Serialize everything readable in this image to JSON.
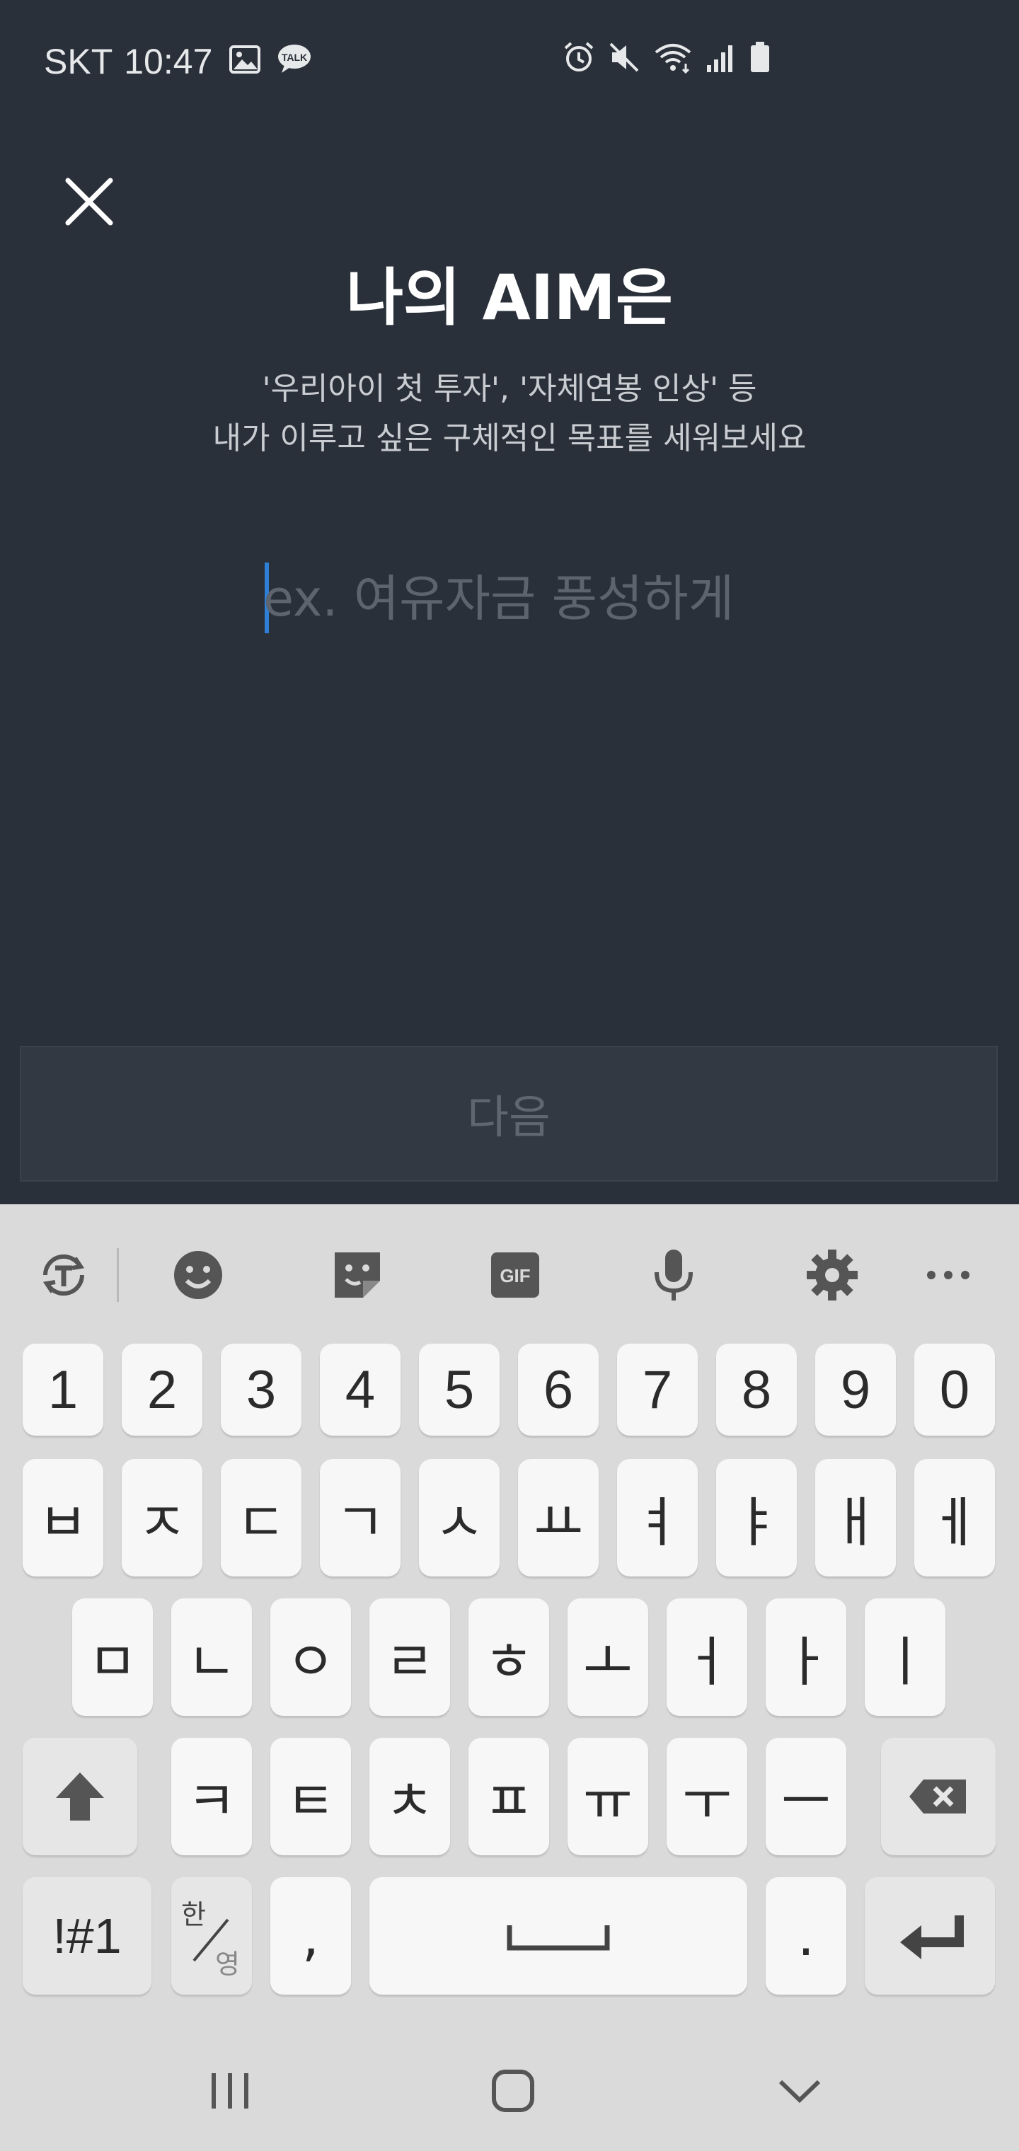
{
  "status_bar": {
    "carrier": "SKT",
    "time": "10:47",
    "left_icons": [
      "gallery-icon",
      "kakaotalk-icon"
    ],
    "right_icons": [
      "alarm-icon",
      "mute-icon",
      "wifi-icon",
      "signal-icon",
      "battery-icon"
    ],
    "kakao_label": "TALK"
  },
  "header": {
    "close_icon": "close-icon",
    "title": "나의 AIM은",
    "subtitle_line1": "'우리아이 첫 투자', '자체연봉 인상' 등",
    "subtitle_line2": "내가 이루고 싶은 구체적인 목표를 세워보세요"
  },
  "aim_input": {
    "value": "",
    "placeholder": "ex. 여유자금 풍성하게"
  },
  "next_button": {
    "label": "다음"
  },
  "keyboard": {
    "toolbar": [
      "translate-icon",
      "emoji-icon",
      "sticker-icon",
      "gif-icon",
      "microphone-icon",
      "settings-icon",
      "more-icon"
    ],
    "gif_label": "GIF",
    "number_row": [
      "1",
      "2",
      "3",
      "4",
      "5",
      "6",
      "7",
      "8",
      "9",
      "0"
    ],
    "row1": [
      "ㅂ",
      "ㅈ",
      "ㄷ",
      "ㄱ",
      "ㅅ",
      "ㅛ",
      "ㅕ",
      "ㅑ",
      "ㅐ",
      "ㅔ"
    ],
    "row2": [
      "ㅁ",
      "ㄴ",
      "ㅇ",
      "ㄹ",
      "ㅎ",
      "ㅗ",
      "ㅓ",
      "ㅏ",
      "ㅣ"
    ],
    "row3": [
      "ㅋ",
      "ㅌ",
      "ㅊ",
      "ㅍ",
      "ㅠ",
      "ㅜ",
      "ㅡ"
    ],
    "symbols_label": "!#1",
    "lang_top": "한",
    "lang_bottom": "영",
    "comma": ",",
    "period": "."
  },
  "colors": {
    "background": "#2a3039",
    "caret": "#2f7fd6",
    "keyboard_bg": "#dadada"
  }
}
